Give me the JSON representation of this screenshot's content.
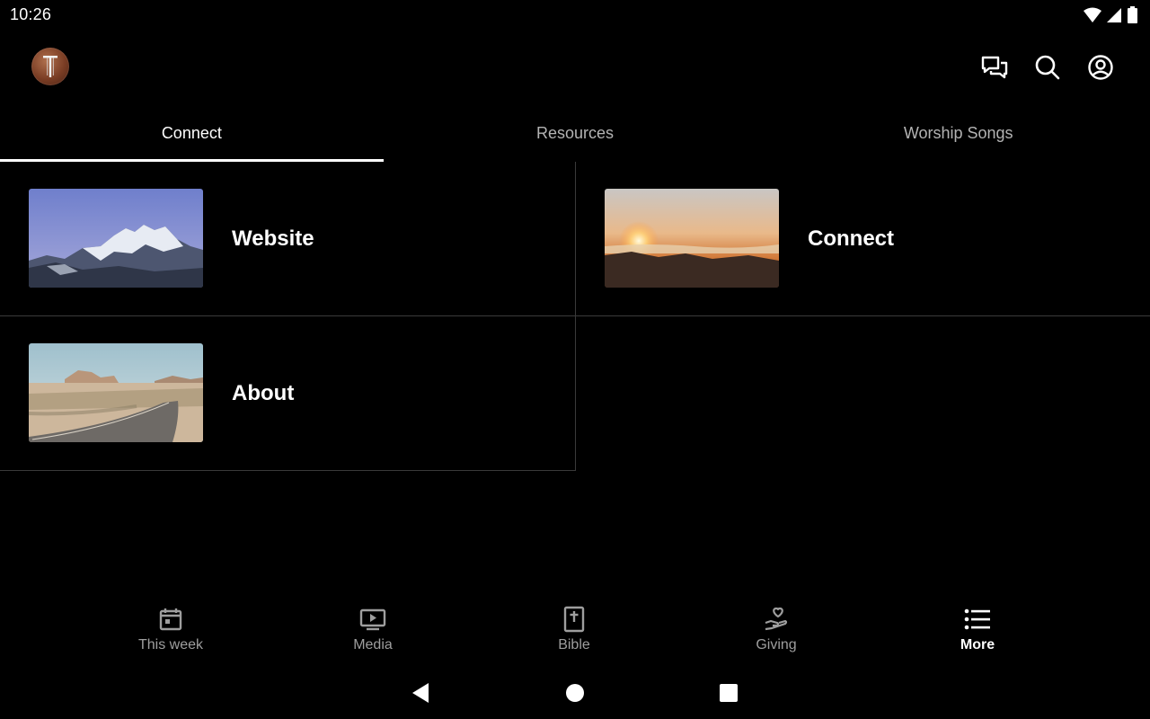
{
  "status_bar": {
    "time": "10:26",
    "icons": [
      "wifi-icon",
      "cell-signal-icon",
      "battery-icon"
    ]
  },
  "app_bar": {
    "avatar": "church-logo-avatar",
    "actions": [
      "chat-icon",
      "search-icon",
      "account-icon"
    ]
  },
  "tabs": [
    {
      "label": "Connect",
      "active": true
    },
    {
      "label": "Resources",
      "active": false
    },
    {
      "label": "Worship Songs",
      "active": false
    }
  ],
  "cards": [
    {
      "title": "Website",
      "image": "snowy-mountains"
    },
    {
      "title": "Connect",
      "image": "sunset-over-clouds"
    },
    {
      "title": "About",
      "image": "desert-road"
    }
  ],
  "bottom_nav": [
    {
      "label": "This week",
      "icon": "calendar-icon",
      "active": false
    },
    {
      "label": "Media",
      "icon": "video-icon",
      "active": false
    },
    {
      "label": "Bible",
      "icon": "bible-icon",
      "active": false
    },
    {
      "label": "Giving",
      "icon": "giving-hand-heart-icon",
      "active": false
    },
    {
      "label": "More",
      "icon": "list-icon",
      "active": true
    }
  ],
  "colors": {
    "background": "#000000",
    "text_primary": "#ffffff",
    "text_inactive": "#9e9e9e",
    "divider": "#3a3a3a"
  }
}
